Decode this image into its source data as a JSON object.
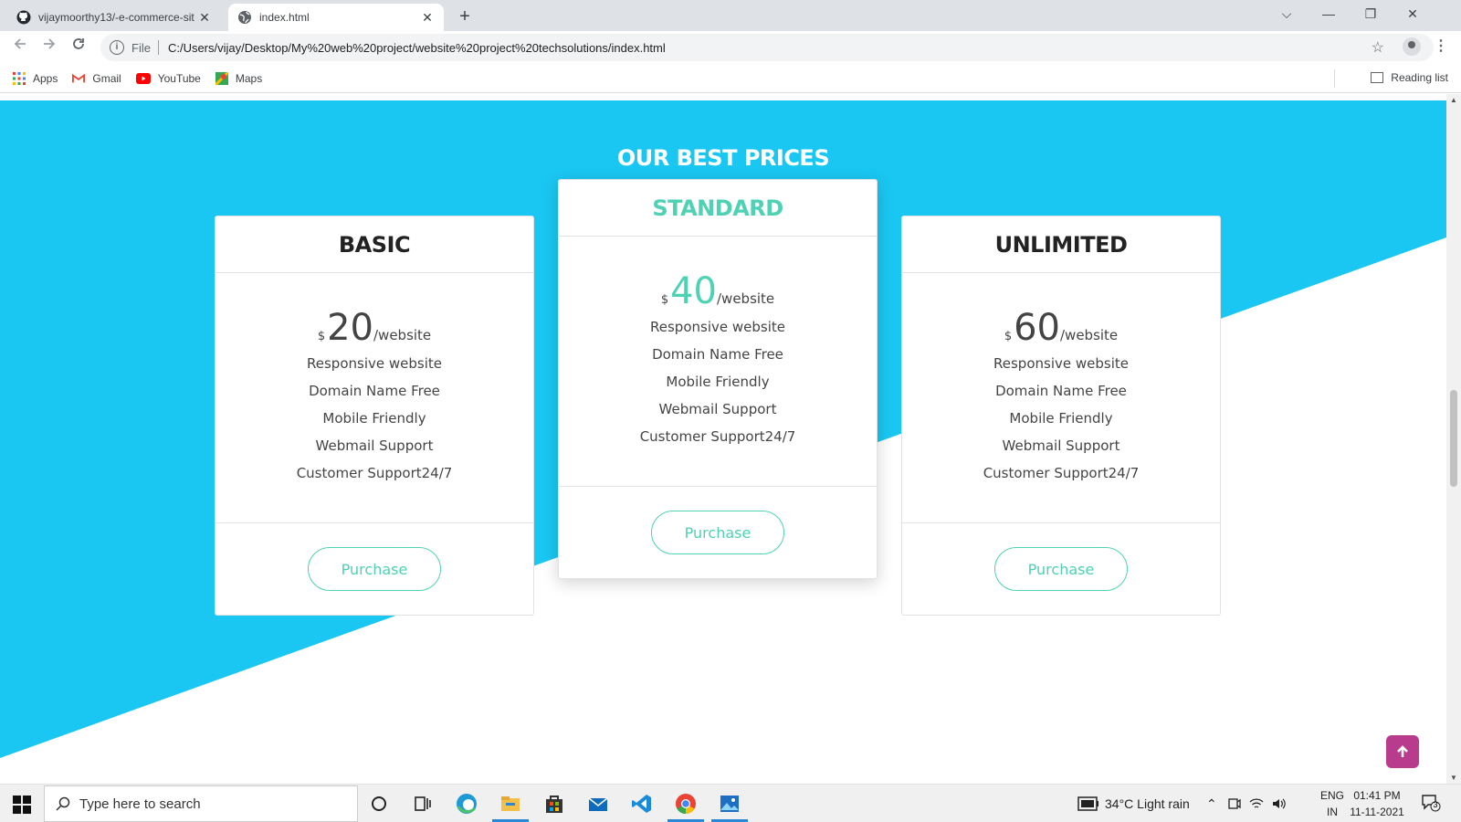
{
  "browser": {
    "tabs": [
      {
        "title": "vijaymoorthy13/-e-commerce-sit",
        "active": false,
        "icon": "github-icon"
      },
      {
        "title": "index.html",
        "active": true,
        "icon": "globe-icon"
      }
    ],
    "address": {
      "scheme_label": "File",
      "url": "C:/Users/vijay/Desktop/My%20web%20project/website%20project%20techsolutions/index.html"
    },
    "bookmarks": [
      {
        "label": "Apps",
        "icon": "apps-grid-icon"
      },
      {
        "label": "Gmail",
        "icon": "gmail-icon"
      },
      {
        "label": "YouTube",
        "icon": "youtube-icon"
      },
      {
        "label": "Maps",
        "icon": "maps-icon"
      }
    ],
    "reading_list_label": "Reading list"
  },
  "page": {
    "section_title": "OUR BEST PRICES",
    "plans": [
      {
        "name": "BASIC",
        "currency": "$",
        "amount": "20",
        "period": "/website",
        "features": [
          "Responsive website",
          "Domain Name Free",
          "Mobile Friendly",
          "Webmail Support",
          "Customer Support24/7"
        ],
        "button": "Purchase",
        "highlighted": false
      },
      {
        "name": "STANDARD",
        "currency": "$",
        "amount": "40",
        "period": "/website",
        "features": [
          "Responsive website",
          "Domain Name Free",
          "Mobile Friendly",
          "Webmail Support",
          "Customer Support24/7"
        ],
        "button": "Purchase",
        "highlighted": true
      },
      {
        "name": "UNLIMITED",
        "currency": "$",
        "amount": "60",
        "period": "/website",
        "features": [
          "Responsive website",
          "Domain Name Free",
          "Mobile Friendly",
          "Webmail Support",
          "Customer Support24/7"
        ],
        "button": "Purchase",
        "highlighted": false
      }
    ],
    "colors": {
      "background_blue": "#1ac7f2",
      "accent_teal": "#4fd1b4",
      "scroll_top_button": "#b83b8e"
    }
  },
  "taskbar": {
    "search_placeholder": "Type here to search",
    "weather": "34°C  Light rain",
    "language": "ENG",
    "region": "IN",
    "time": "01:41 PM",
    "date": "11-11-2021",
    "notification_count": "3"
  }
}
